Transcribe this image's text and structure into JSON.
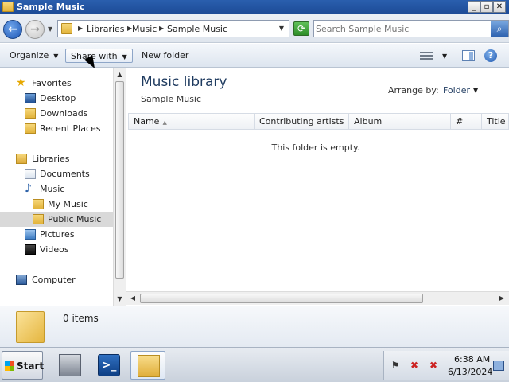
{
  "window": {
    "title": "Sample Music"
  },
  "address_bar": {
    "crumbs": [
      "Libraries",
      "Music",
      "Sample Music"
    ],
    "search_placeholder": "Search Sample Music"
  },
  "command_bar": {
    "organize": "Organize",
    "share_with": "Share with",
    "new_folder": "New folder"
  },
  "nav_pane": {
    "favorites": "Favorites",
    "desktop": "Desktop",
    "downloads": "Downloads",
    "recent_places": "Recent Places",
    "libraries": "Libraries",
    "documents": "Documents",
    "music": "Music",
    "my_music": "My Music",
    "public_music": "Public Music",
    "pictures": "Pictures",
    "videos": "Videos",
    "computer": "Computer"
  },
  "content": {
    "title": "Music library",
    "subtitle": "Sample Music",
    "arrange_by_label": "Arrange by:",
    "arrange_by_value": "Folder",
    "columns": [
      "Name",
      "Contributing artists",
      "Album",
      "#",
      "Title"
    ],
    "empty_message": "This folder is empty."
  },
  "details_pane": {
    "item_count": "0 items"
  },
  "taskbar": {
    "start": "Start",
    "clock_time": "6:38 AM",
    "clock_date": "6/13/2024"
  }
}
